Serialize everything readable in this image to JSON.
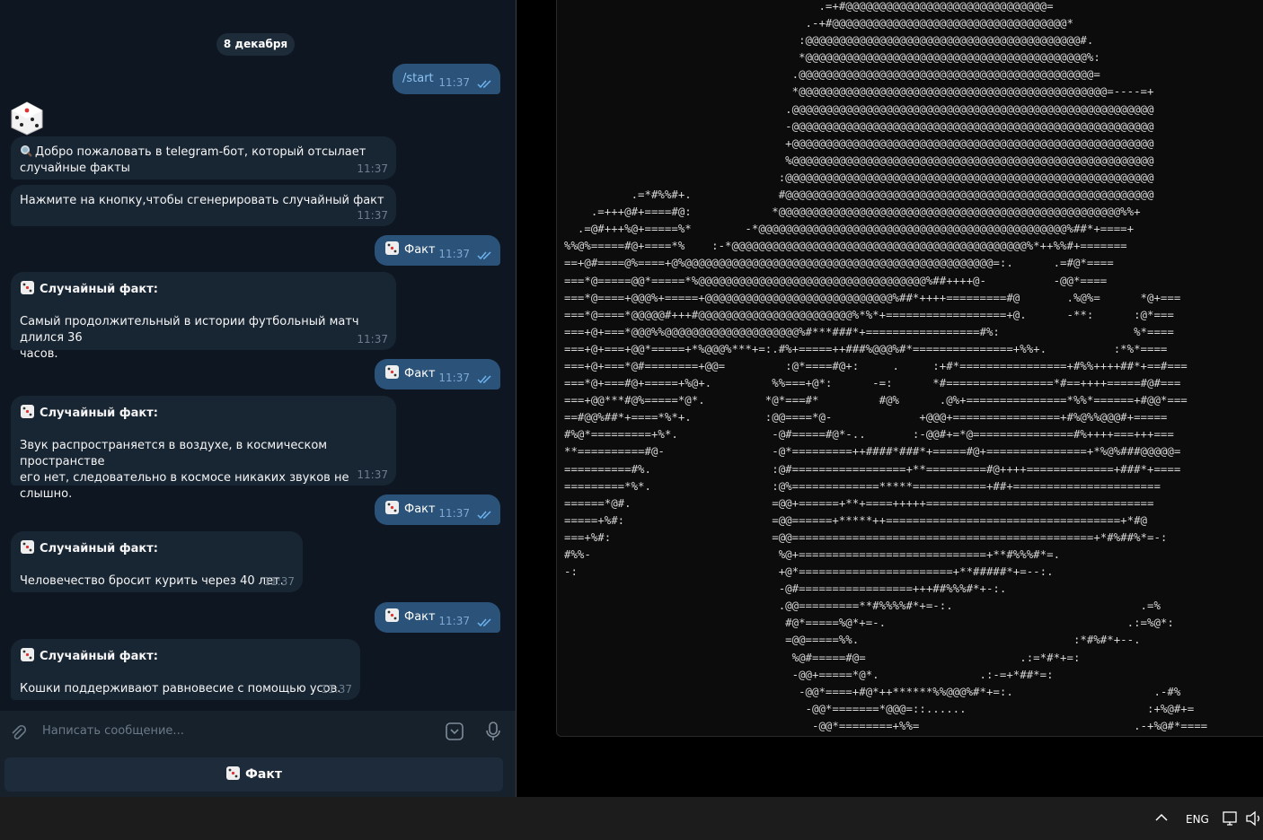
{
  "chat": {
    "date": "8 декабря",
    "start_cmd": "/start",
    "time": "11:37",
    "welcome": "Добро пожаловать в telegram-бот, который отсылает случайные факты",
    "welcome_line1": "Добро пожаловать в telegram-бот, который отсылает",
    "welcome_line2": "случайные факты",
    "prompt": "Нажмите на кнопку,чтобы сгенерировать случайный факт",
    "fact_btn": "Факт",
    "fact_header": "Случайный факт:",
    "facts": [
      {
        "line1": "Самый продолжительный в истории футбольный матч длился 36",
        "line2": "часов."
      },
      {
        "line1": "Звук распространяется в воздухе, в космическом пространстве",
        "line2": "его нет, следовательно в космосе никаких звуков не слышно."
      },
      {
        "line1": "Человечество бросит курить через 40 лет.",
        "line2": ""
      },
      {
        "line1": "Кошки поддерживают равновесие с помощью усов.",
        "line2": ""
      }
    ],
    "composer_placeholder": "Написать сообщение...",
    "keyboard_button": "Факт"
  },
  "taskbar": {
    "language": "ENG"
  },
  "terminal": {
    "ascii_art": "                                      .=+#@@@@@@@@@@@@@@@@@@@@@@@@@@@@@@=\n                                    .-+#@@@@@@@@@@@@@@@@@@@@@@@@@@@@@@@@@@@*\n                                   :@@@@@@@@@@@@@@@@@@@@@@@@@@@@@@@@@@@@@@@@@#.\n                                   *@@@@@@@@@@@@@@@@@@@@@@@@@@@@@@@@@@@@@@@@@@%:\n                                  .@@@@@@@@@@@@@@@@@@@@@@@@@@@@@@@@@@@@@@@@@@@@=\n                                  *@@@@@@@@@@@@@@@@@@@@@@@@@@@@@@@@@@@@@@@@@@@@@@=----=+\n                                 .@@@@@@@@@@@@@@@@@@@@@@@@@@@@@@@@@@@@@@@@@@@@@@@@@@@@@@\n                                 -@@@@@@@@@@@@@@@@@@@@@@@@@@@@@@@@@@@@@@@@@@@@@@@@@@@@@@\n                                 +@@@@@@@@@@@@@@@@@@@@@@@@@@@@@@@@@@@@@@@@@@@@@@@@@@@@@@\n                                 %@@@@@@@@@@@@@@@@@@@@@@@@@@@@@@@@@@@@@@@@@@@@@@@@@@@@@@\n                                :@@@@@@@@@@@@@@@@@@@@@@@@@@@@@@@@@@@@@@@@@@@@@@@@@@@@@@@\n          .=*#%%#+.             #@@@@@@@@@@@@@@@@@@@@@@@@@@@@@@@@@@@@@@@@@@@@@@@@@@@@@@@\n    .=+++@#+====#@:            *@@@@@@@@@@@@@@@@@@@@@@@@@@@@@@@@@@@@@@@@@@@@@@@@@@@%%+\n  .=@#+++%@+=====%*        -*@@@@@@@@@@@@@@@@@@@@@@@@@@@@@@@@@@@@@@@@@@@@@@%##*+====+\n%%@%=====#@+====*%    :-*@@@@@@@@@@@@@@@@@@@@@@@@@@@@@@@@@@@@@@@@@@@@%*++%%#+=======\n==+@#====@%====+@%@@@@@@@@@@@@@@@@@@@@@@@@@@@@@@@@@@@@@@@@@@@@@@=:.      .=#@*====\n===*@=====@@*=====*%@@@@@@@@@@@@@@@@@@@@@@@@@@@@@@@@@@%##++++@-          -@@*====\n===*@====+@@@%+=====+@@@@@@@@@@@@@@@@@@@@@@@@@@@@%##*++++=========#@       .%@%=      *@+===\n===*@====*@@@@@#+++#@@@@@@@@@@@@@@@@@@@@@@@%*%*+==================+@.      -**:      :@*===\n===+@+===*@@@%%@@@@@@@@@@@@@@@@@@@@%#***###*+=================#%:                    %*====\n===+@+===+@@*=====+*%@@@%***+=:.#%+=====++###%@@@%#*===============+%%+.          :*%*====\n===+@+===*@#========+@@=         :@*====#@+:     .     :+#*================+#%%++++##*+==#===\n===*@+===#@+=====+%@+.         %%===+@*:      -=:      *#================*#==++++=====#@#===\n===+@@***#@%=====*@*.         *@*===#*         #@%      .@%+===============*%%*======+#@@*===\n==#@@%##*+====*%*+.           :@@====*@-             +@@@+================+#%@%%@@@#+=====\n#%@*=========+%*.              -@#=====#@*-..       :-@@#+=*@===============#%++++===+++===\n**==========#@-                -@*=========++####*###*+=====#@+===============+*%@%###@@@@@=\n==========#%.                  :@#=================+**=========#@++++=============+###*+====\n=========*%*.                  :@%=============*****===========+##+======================\n======*@#.                     =@@+======+**+====+++++==================================\n=====+%#:                      =@@======+*****++===================================+*#@\n===+%#:                        =@@=============================================+*#%##%*=-:\n#%%-                            %@+============================+**#%%%#*=.\n-:                              +@*=======================+**#####*+=--:.\n                                -@#=================+++##%%%#*+-:.\n                                .@@=========**#%%%%#*+=-:.                            .=%\n                                 #@*=====%@*+=-.                                    .:=%@*:\n                                 =@@=====%%.                                :*#%#*+--.\n                                  %@#=====#@=                       .:=*#*+=:\n                                  -@@+=====*@*.               .:-=+*##*=:\n                                   -@@*====+#@*++******%%@@@%#*+=:.                     .-#%\n                                    -@@*=======*@@@=::......                           :+%@#+=\n                                     -@@*========+%%=                                .-+%@#*===="
  }
}
